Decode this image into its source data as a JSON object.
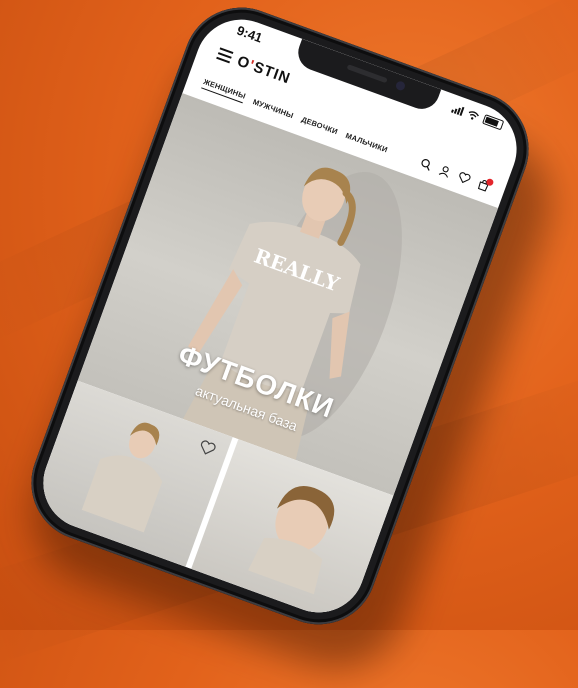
{
  "status": {
    "time": "9:41"
  },
  "header": {
    "logo_left": "O",
    "logo_mark": "'",
    "logo_right": "STIN"
  },
  "nav": {
    "tabs": [
      "ЖЕНЩИНЫ",
      "МУЖЧИНЫ",
      "ДЕВОЧКИ",
      "МАЛЬЧИКИ"
    ],
    "active_tab": "ЖЕНЩИНЫ"
  },
  "hero": {
    "shirt_print": "REALLY",
    "title": "ФУТБОЛКИ",
    "subtitle": "актуальная база"
  },
  "icons": {
    "menu": "hamburger-icon",
    "search": "search-icon",
    "account": "user-icon",
    "favorites": "heart-icon",
    "cart": "shopping-bag-icon",
    "card_favorite": "heart-outline-icon"
  },
  "colors": {
    "background": "#e2621b",
    "logo_accent": "#d2342d",
    "cart_badge": "#e3252b",
    "phone_body": "#1b1b1d"
  }
}
